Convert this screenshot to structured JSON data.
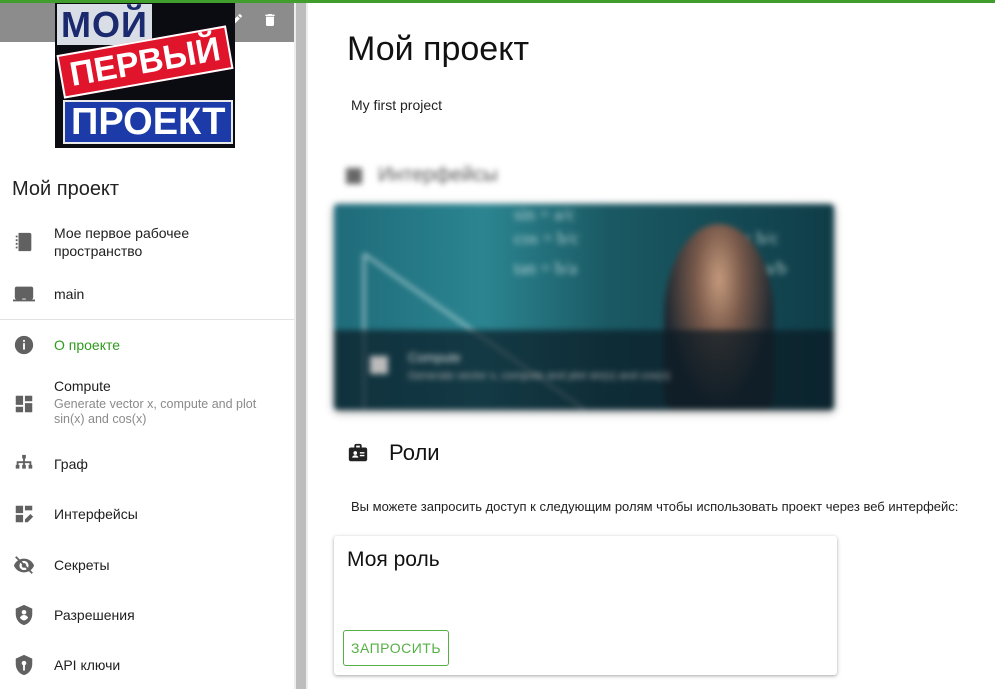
{
  "sidebar": {
    "project_name": "Мой проект",
    "logo_text": [
      "МОЙ",
      "ПЕРВЫЙ",
      "ПРОЕКТ"
    ],
    "header_icons": [
      "edit-icon",
      "delete-icon"
    ],
    "items": [
      {
        "label": "Мое первое рабочее пространство",
        "icon": "notebook-icon"
      },
      {
        "label": "main",
        "icon": "computer-icon"
      },
      {
        "label": "О проекте",
        "icon": "info-icon",
        "active": true
      },
      {
        "label": "Compute",
        "sub": "Generate vector x, compute and plot sin(x) and cos(x)",
        "icon": "dashboard-icon"
      },
      {
        "label": "Граф",
        "icon": "graph-icon"
      },
      {
        "label": "Интерфейсы",
        "icon": "interface-icon"
      },
      {
        "label": "Секреты",
        "icon": "eye-off-icon"
      },
      {
        "label": "Разрешения",
        "icon": "shield-icon"
      },
      {
        "label": "API ключи",
        "icon": "key-shield-icon"
      }
    ]
  },
  "main": {
    "title": "Мой проект",
    "description": "My first project",
    "interfaces_section": {
      "title": "Интерфейсы",
      "card_title": "Compute",
      "card_sub": "Generate vector x, compute and plot sin(x) and cos(x)",
      "formulas": [
        "sin  =  a/c",
        "cos  =  b/c",
        "tan  =  b/a",
        "cosα  =  b/c",
        "cotα  =  a/b"
      ]
    },
    "roles_section": {
      "title": "Роли",
      "description": "Вы можете запросить доступ к следующим ролям чтобы использовать проект через веб интерфейс:",
      "role_title": "Моя роль",
      "request_button": "ЗАПРОСИТЬ"
    }
  },
  "colors": {
    "accent": "#2f9a1e",
    "button_green": "#57b046",
    "top_line": "#3f9e2c",
    "header_gray": "#8c8c8c"
  }
}
